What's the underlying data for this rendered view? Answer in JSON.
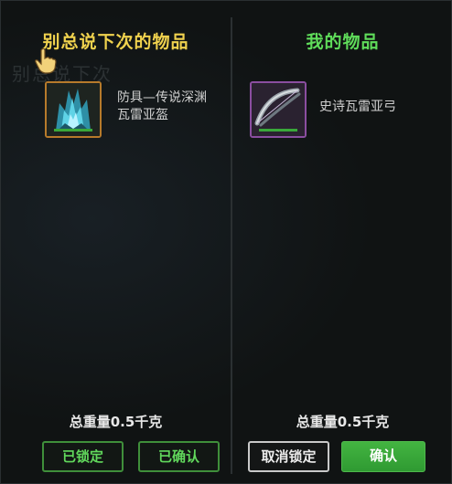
{
  "left_panel": {
    "title": "别总说下次的物品",
    "ghost_text": "别总说下次",
    "item": {
      "name": "防具—传说深渊瓦雷亚盔",
      "rarity": "legendary",
      "border_color": "#b77a2b",
      "icon": "armor-helmet-icon"
    },
    "weight_label": "总重量0.5千克",
    "buttons": {
      "locked_label": "已锁定",
      "confirmed_label": "已确认"
    }
  },
  "right_panel": {
    "title": "我的物品",
    "item": {
      "name": "史诗瓦雷亚弓",
      "rarity": "epic",
      "border_color": "#8b4ea0",
      "icon": "bow-icon"
    },
    "weight_label": "总重量0.5千克",
    "buttons": {
      "unlock_label": "取消锁定",
      "confirm_label": "确认"
    }
  },
  "colors": {
    "left_title": "#f0d24e",
    "right_title": "#5fdc5a",
    "confirm_button": "#3aa83a"
  }
}
